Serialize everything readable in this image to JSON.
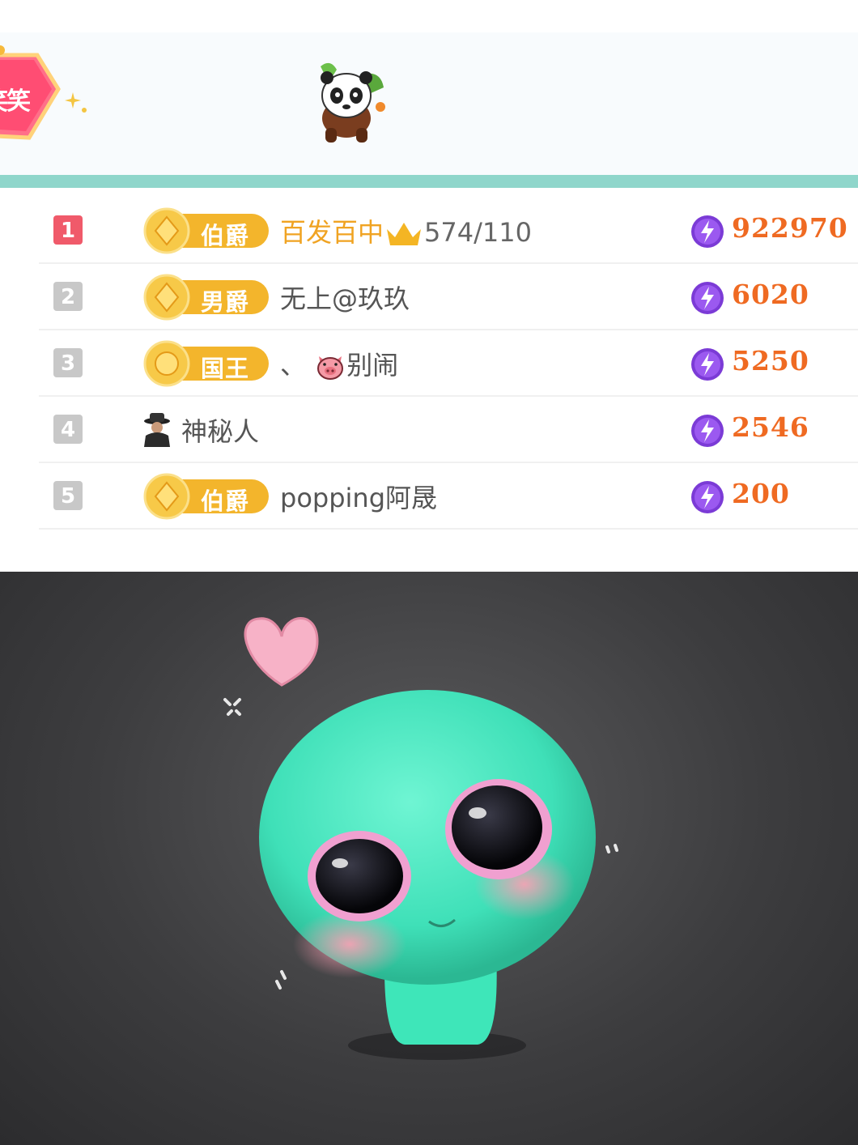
{
  "banner": {
    "badge_text": "笑笑"
  },
  "ranking": {
    "rows": [
      {
        "rank": "1",
        "medal": "伯爵",
        "name": "百发百中",
        "stats": "574/110",
        "score": "922970"
      },
      {
        "rank": "2",
        "medal": "男爵",
        "name": "无上@玖玖",
        "score": "6020"
      },
      {
        "rank": "3",
        "medal": "国王",
        "name_prefix": "、",
        "name": "别闹",
        "score": "5250"
      },
      {
        "rank": "4",
        "name": "神秘人",
        "score": "2546"
      },
      {
        "rank": "5",
        "medal": "伯爵",
        "name": "popping阿晟",
        "score": "200"
      }
    ]
  },
  "colors": {
    "teal_bar": "#8fd6cb",
    "rank1": "#f05a6a",
    "rank_other": "#c8c8c8",
    "medal_gold": "#f3b52c",
    "score": "#ef6a22",
    "coin": "#7b3bd6",
    "top_name": "#f0a322"
  }
}
